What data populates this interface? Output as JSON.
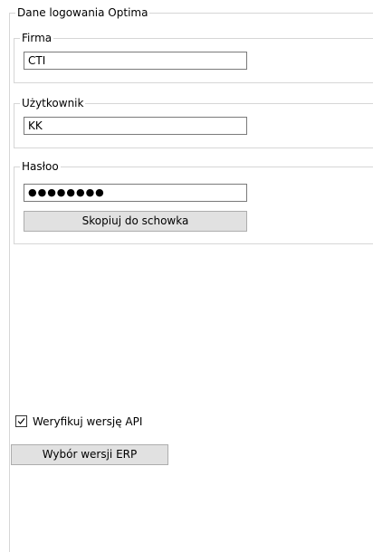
{
  "outer_group": {
    "title": "Dane logowania Optima"
  },
  "firma": {
    "title": "Firma",
    "value": "CTI"
  },
  "user": {
    "title": "Użytkownik",
    "value": "KK"
  },
  "password": {
    "title": "Hasłoo",
    "value": "●●●●●●●●",
    "copy_button": "Skopiuj do schowka"
  },
  "verify_api": {
    "label": "Weryfikuj wersję API",
    "checked": true
  },
  "erp_button": {
    "label": "Wybór wersji ERP"
  }
}
